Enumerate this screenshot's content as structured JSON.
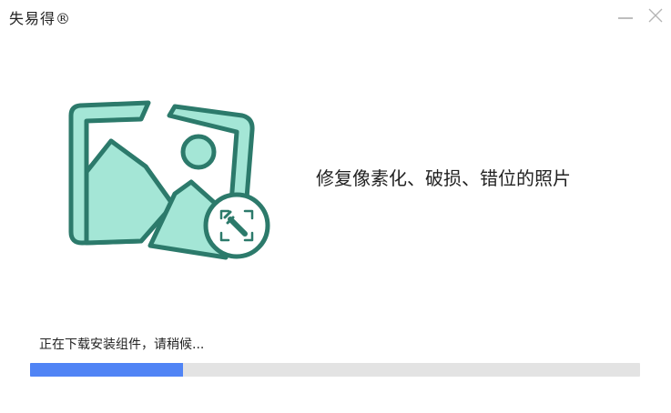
{
  "window": {
    "title": "失易得®",
    "minimize_icon": "minimize-icon",
    "close_icon": "close-icon"
  },
  "illustration": {
    "icon": "broken-photo-repair-icon",
    "badge_icon": "wrench-icon",
    "colors": {
      "fill": "#a4e6d6",
      "stroke": "#2c7a6b",
      "badge_bg": "#ffffff"
    }
  },
  "main": {
    "headline": "修复像素化、破损、错位的照片"
  },
  "progress": {
    "status": "正在下载安装组件，请稍候...",
    "fraction": 0.25,
    "fill_color": "#5084f5",
    "track_color": "#e3e3e3"
  }
}
